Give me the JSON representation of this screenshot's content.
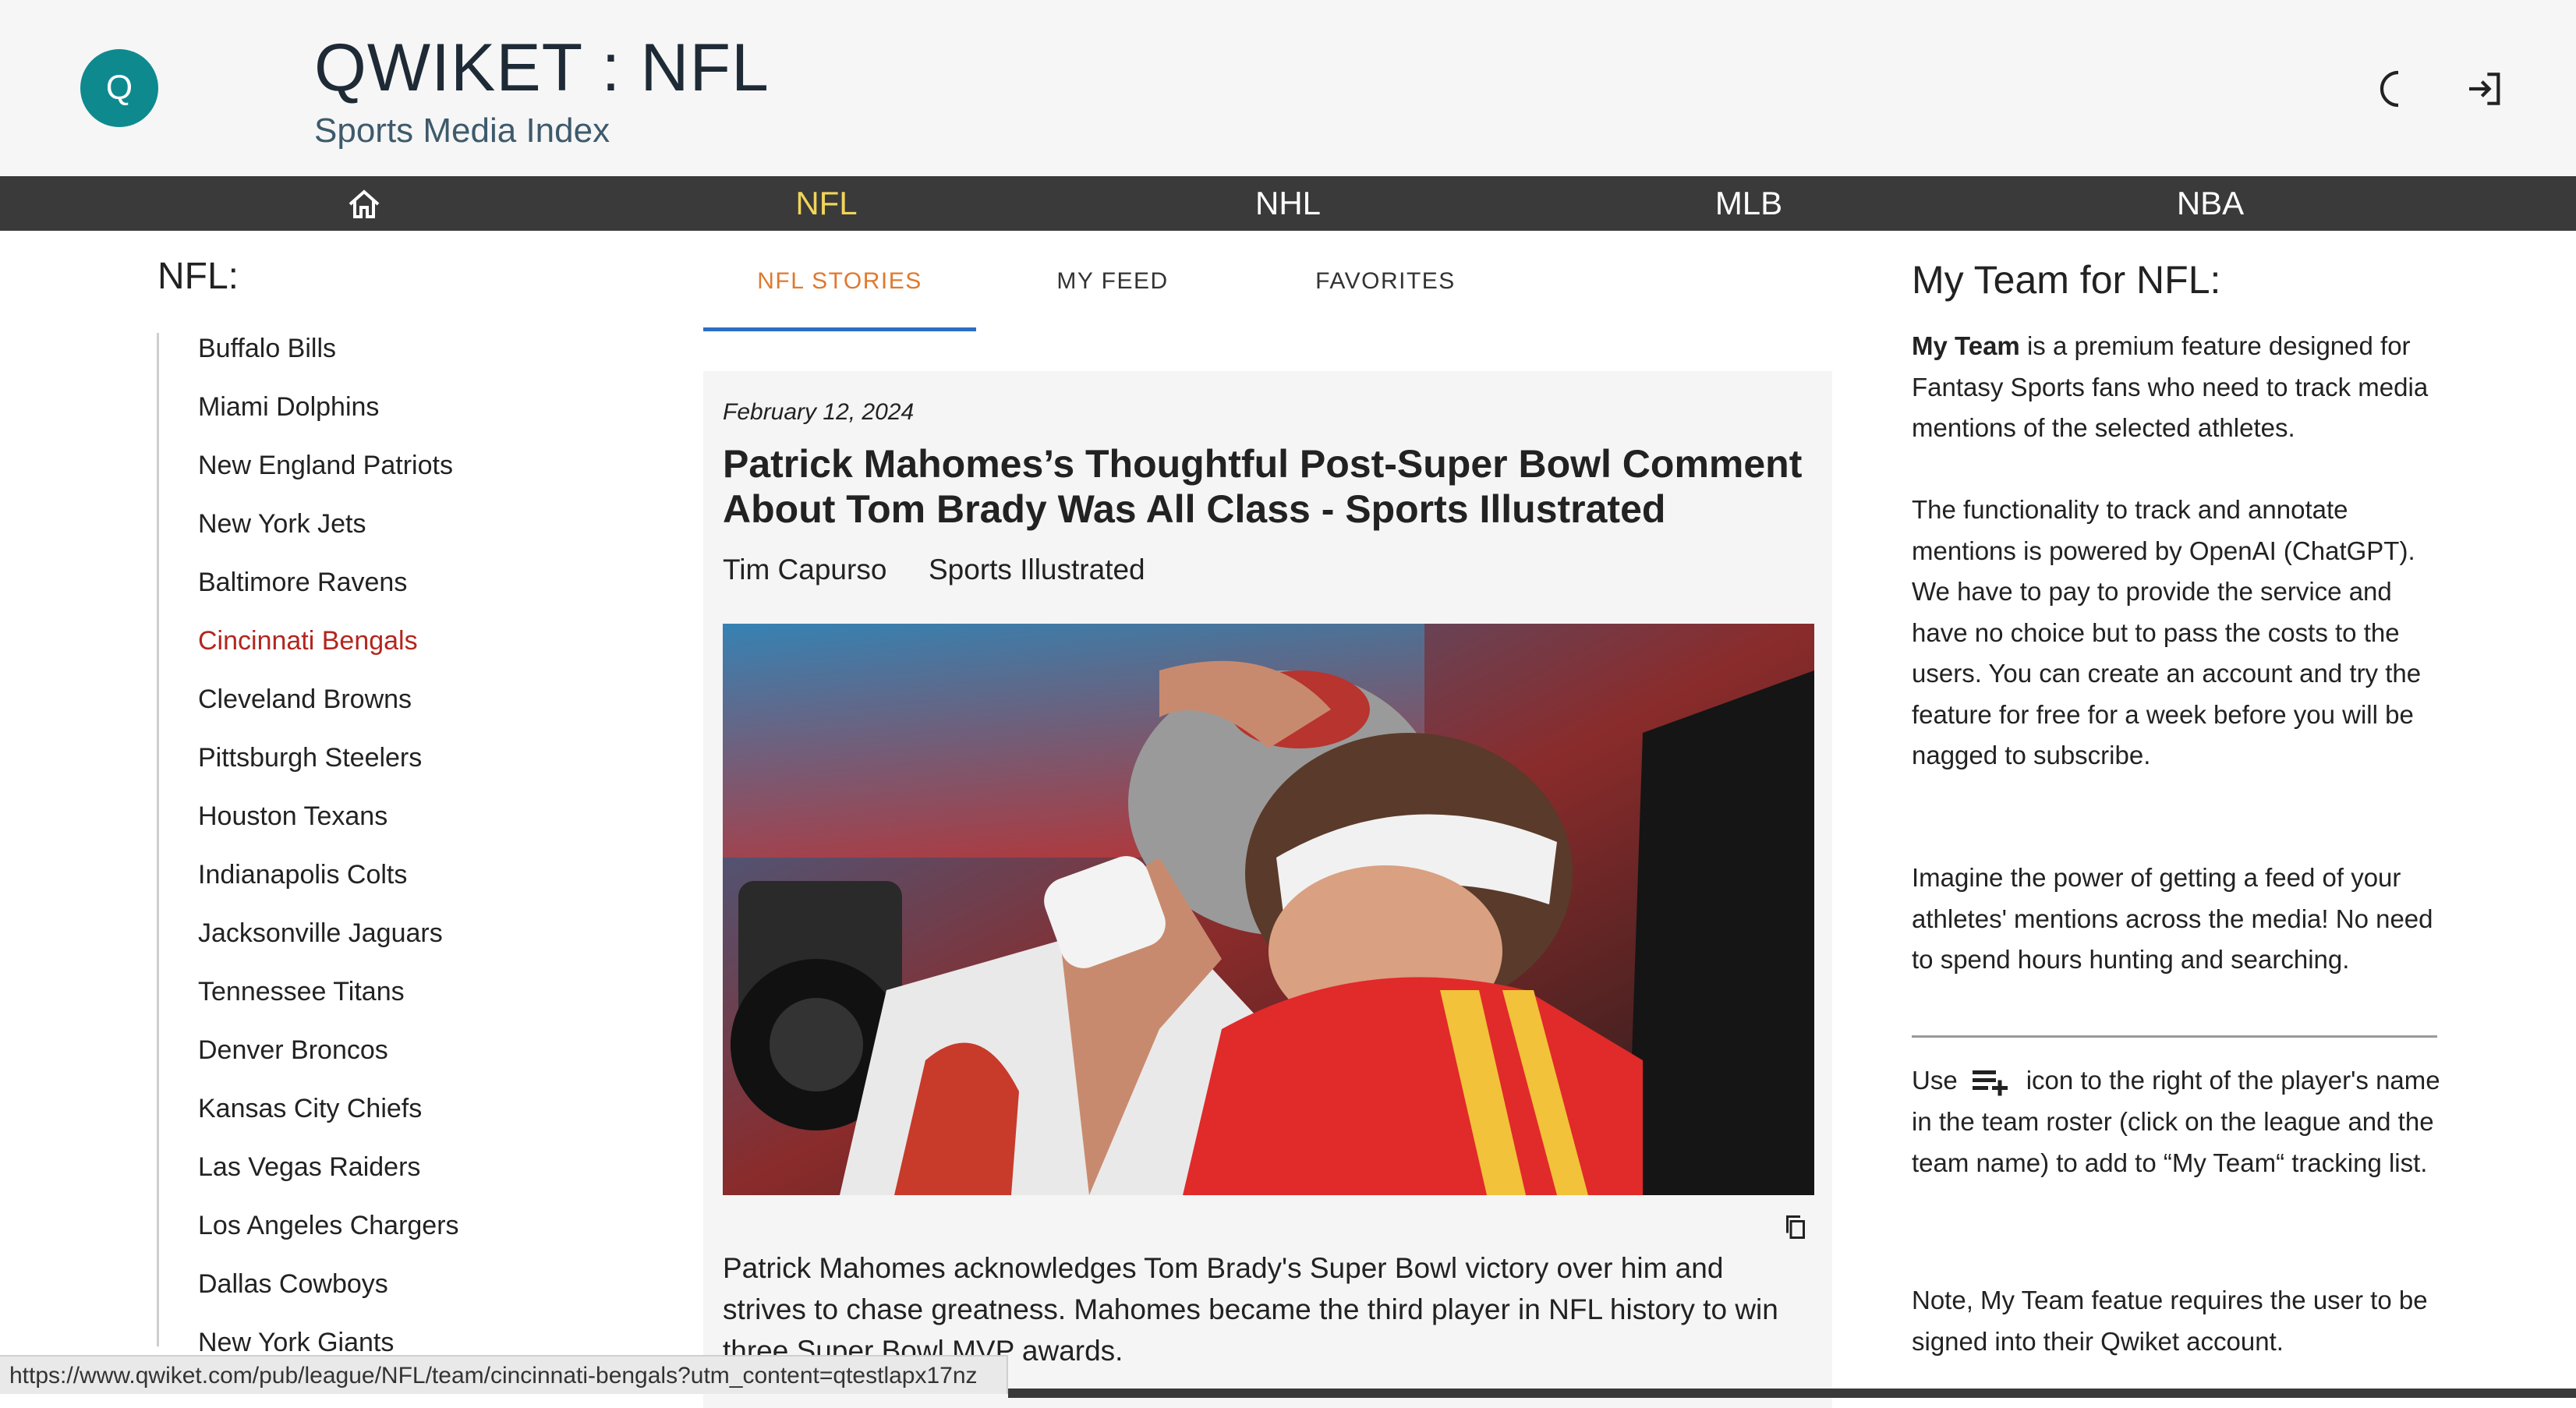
{
  "header": {
    "logo_letter": "Q",
    "title": "QWIKET : NFL",
    "subtitle": "Sports Media Index",
    "icons": [
      "dark-mode-icon",
      "login-icon"
    ]
  },
  "nav": {
    "home_icon": "home-icon",
    "items": [
      {
        "label": "NFL",
        "active": true
      },
      {
        "label": "NHL",
        "active": false
      },
      {
        "label": "MLB",
        "active": false
      },
      {
        "label": "NBA",
        "active": false
      }
    ]
  },
  "left": {
    "title": "NFL:",
    "teams": [
      "Buffalo Bills",
      "Miami Dolphins",
      "New England Patriots",
      "New York Jets",
      "Baltimore Ravens",
      "Cincinnati Bengals",
      "Cleveland Browns",
      "Pittsburgh Steelers",
      "Houston Texans",
      "Indianapolis Colts",
      "Jacksonville Jaguars",
      "Tennessee Titans",
      "Denver Broncos",
      "Kansas City Chiefs",
      "Las Vegas Raiders",
      "Los Angeles Chargers",
      "Dallas Cowboys",
      "New York Giants"
    ],
    "active_team": "Cincinnati Bengals"
  },
  "tabs": [
    {
      "label": "NFL STORIES",
      "active": true
    },
    {
      "label": "MY FEED",
      "active": false
    },
    {
      "label": "FAVORITES",
      "active": false
    }
  ],
  "story": {
    "date": "February 12, 2024",
    "headline": "Patrick Mahomes’s Thoughtful Post-Super Bowl Comment About Tom Brady Was All Class - Sports Illustrated",
    "author": "Tim Capurso",
    "source": "Sports Illustrated",
    "summary": "Patrick Mahomes acknowledges Tom Brady's Super Bowl victory over him and strives to chase greatness. Mahomes became the third player in NFL history to win three Super Bowl MVP awards.",
    "copy_icon": "copy-icon"
  },
  "right": {
    "title": "My Team for NFL:",
    "p1_bold": "My Team",
    "p1_rest": " is a premium feature designed for Fantasy Sports fans who need to track media mentions of the selected athletes.",
    "p2": "The functionality to track and annotate mentions is powered by OpenAI (ChatGPT). We have to pay to provide the service and have no choice but to pass the costs to the users. You can create an account and try the feature for free for a week before you will be nagged to subscribe.",
    "p3": "Imagine the power of getting a feed of your athletes' mentions across the media! No need to spend hours hunting and searching.",
    "p4_before": "Use",
    "p4_icon": "playlist-add-icon",
    "p4_after": "icon to the right of the player's name in the team roster (click on the league and the team name) to add to “My Team“ tracking list.",
    "p5": "Note, My Team featue requires the user to be signed into their Qwiket account."
  },
  "status_url": "https://www.qwiket.com/pub/league/NFL/team/cincinnati-bengals?utm_content=qtestlapx17nz"
}
